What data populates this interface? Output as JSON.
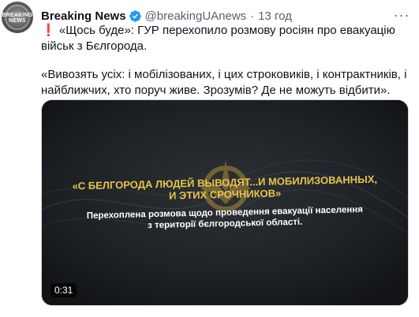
{
  "account": {
    "display_name": "Breaking News",
    "handle": "@breakingUAnews",
    "separator": "·",
    "time": "13 год",
    "avatar_text": "BREAKING NEWS",
    "verified_icon": "verified-badge-icon",
    "verified_color": "#1d9bf0"
  },
  "menu": {
    "more_icon": "more-dots-icon",
    "more_glyph": "···"
  },
  "tweet": {
    "emoji": "❗",
    "paragraph1": " «Щось буде»: ГУР перехопило розмову росіян про евакуацію військ з Бєлгорода.",
    "paragraph2": "«Вивозять усіх: і мобілізованих, і цих строковиків, і контрактників, і найближчих, хто поруч живе. Зрозумів? Де не можуть відбити»."
  },
  "media": {
    "headline_line1": "«С белгорода людей выводят...и мобилизованных,",
    "headline_line2": "и этих срочников»",
    "subline_line1": "Перехоплена розмова щодо проведення евакуації населення",
    "subline_line2": "з території бєлгородської області.",
    "duration": "0:31",
    "accent_color": "#e9c34c",
    "emblem_icon": "gur-emblem-icon"
  }
}
